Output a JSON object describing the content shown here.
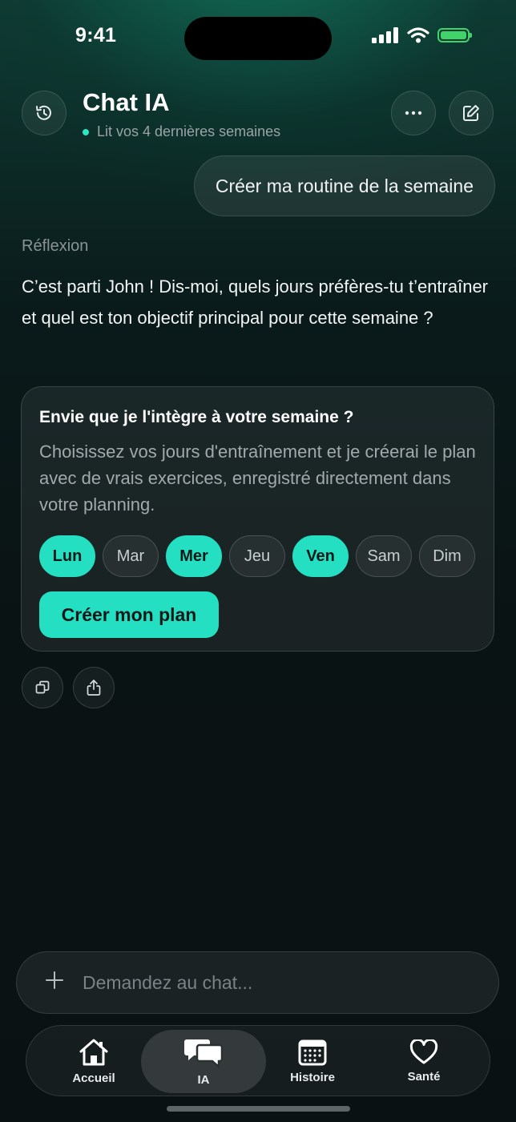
{
  "status_bar": {
    "time": "9:41"
  },
  "header": {
    "title": "Chat IA",
    "subtitle": "Lit vos 4 dernières semaines"
  },
  "conversation": {
    "user_message": "Créer ma routine de la semaine",
    "reflexion_label": "Réflexion",
    "ai_message": "C’est parti John ! Dis-moi, quels jours préfères-tu t’entraîner et quel est ton objectif principal pour cette semaine ?"
  },
  "card": {
    "title": "Envie que je l'intègre à votre semaine ?",
    "description": "Choisissez vos jours d'entraînement et je créerai le plan avec de vrais exercices, enregistré directement dans votre planning.",
    "days": [
      {
        "label": "Lun",
        "selected": true
      },
      {
        "label": "Mar",
        "selected": false
      },
      {
        "label": "Mer",
        "selected": true
      },
      {
        "label": "Jeu",
        "selected": false
      },
      {
        "label": "Ven",
        "selected": true
      },
      {
        "label": "Sam",
        "selected": false
      },
      {
        "label": "Dim",
        "selected": false
      }
    ],
    "cta_label": "Créer mon plan"
  },
  "composer": {
    "placeholder": "Demandez au chat..."
  },
  "tabbar": {
    "items": [
      {
        "label": "Accueil",
        "icon": "home-icon",
        "active": false
      },
      {
        "label": "IA",
        "icon": "chat-bubbles-icon",
        "active": true
      },
      {
        "label": "Histoire",
        "icon": "calendar-icon",
        "active": false
      },
      {
        "label": "Santé",
        "icon": "heart-icon",
        "active": false
      }
    ]
  },
  "colors": {
    "accent": "#25dfc3",
    "battery": "#41d36a",
    "background": "#0a1113"
  }
}
